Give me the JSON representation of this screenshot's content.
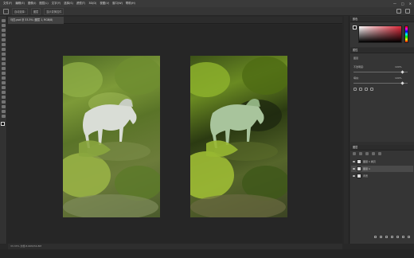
{
  "menu": {
    "items": [
      "文件(F)",
      "编辑(E)",
      "图像(I)",
      "图层(L)",
      "文字(Y)",
      "选择(S)",
      "滤镜(T)",
      "3D(D)",
      "视图(V)",
      "窗口(W)",
      "帮助(H)"
    ],
    "window_controls": [
      "—",
      "□",
      "✕"
    ]
  },
  "options": {
    "items": [
      "自动选择:",
      "图层",
      "显示变换控件"
    ]
  },
  "document": {
    "tab_title": "马匹.psd @ 33.3% (图层 1, RGB/8)",
    "status": "33.33%   文档:8.66M/34.8M"
  },
  "colors": {
    "accent": "#e0293a",
    "foreground": "#111111",
    "background": "#ffffff"
  },
  "panels": {
    "color_title": "颜色",
    "properties_title": "属性",
    "properties_rows": [
      "图层",
      "不透明度:",
      "填充:"
    ],
    "properties_values": [
      "100%",
      "100%"
    ],
    "layers_title": "图层",
    "layers": [
      {
        "name": "图层 1 拷贝",
        "selected": false
      },
      {
        "name": "图层 1",
        "selected": true
      },
      {
        "name": "背景",
        "selected": false
      }
    ]
  },
  "icons": [
    "move-tool-icon",
    "marquee-icon",
    "lasso-icon",
    "crop-icon",
    "eyedropper-icon",
    "brush-icon",
    "eraser-icon",
    "gradient-icon",
    "text-icon",
    "hand-icon",
    "zoom-icon",
    "eye-icon",
    "lock-icon"
  ]
}
